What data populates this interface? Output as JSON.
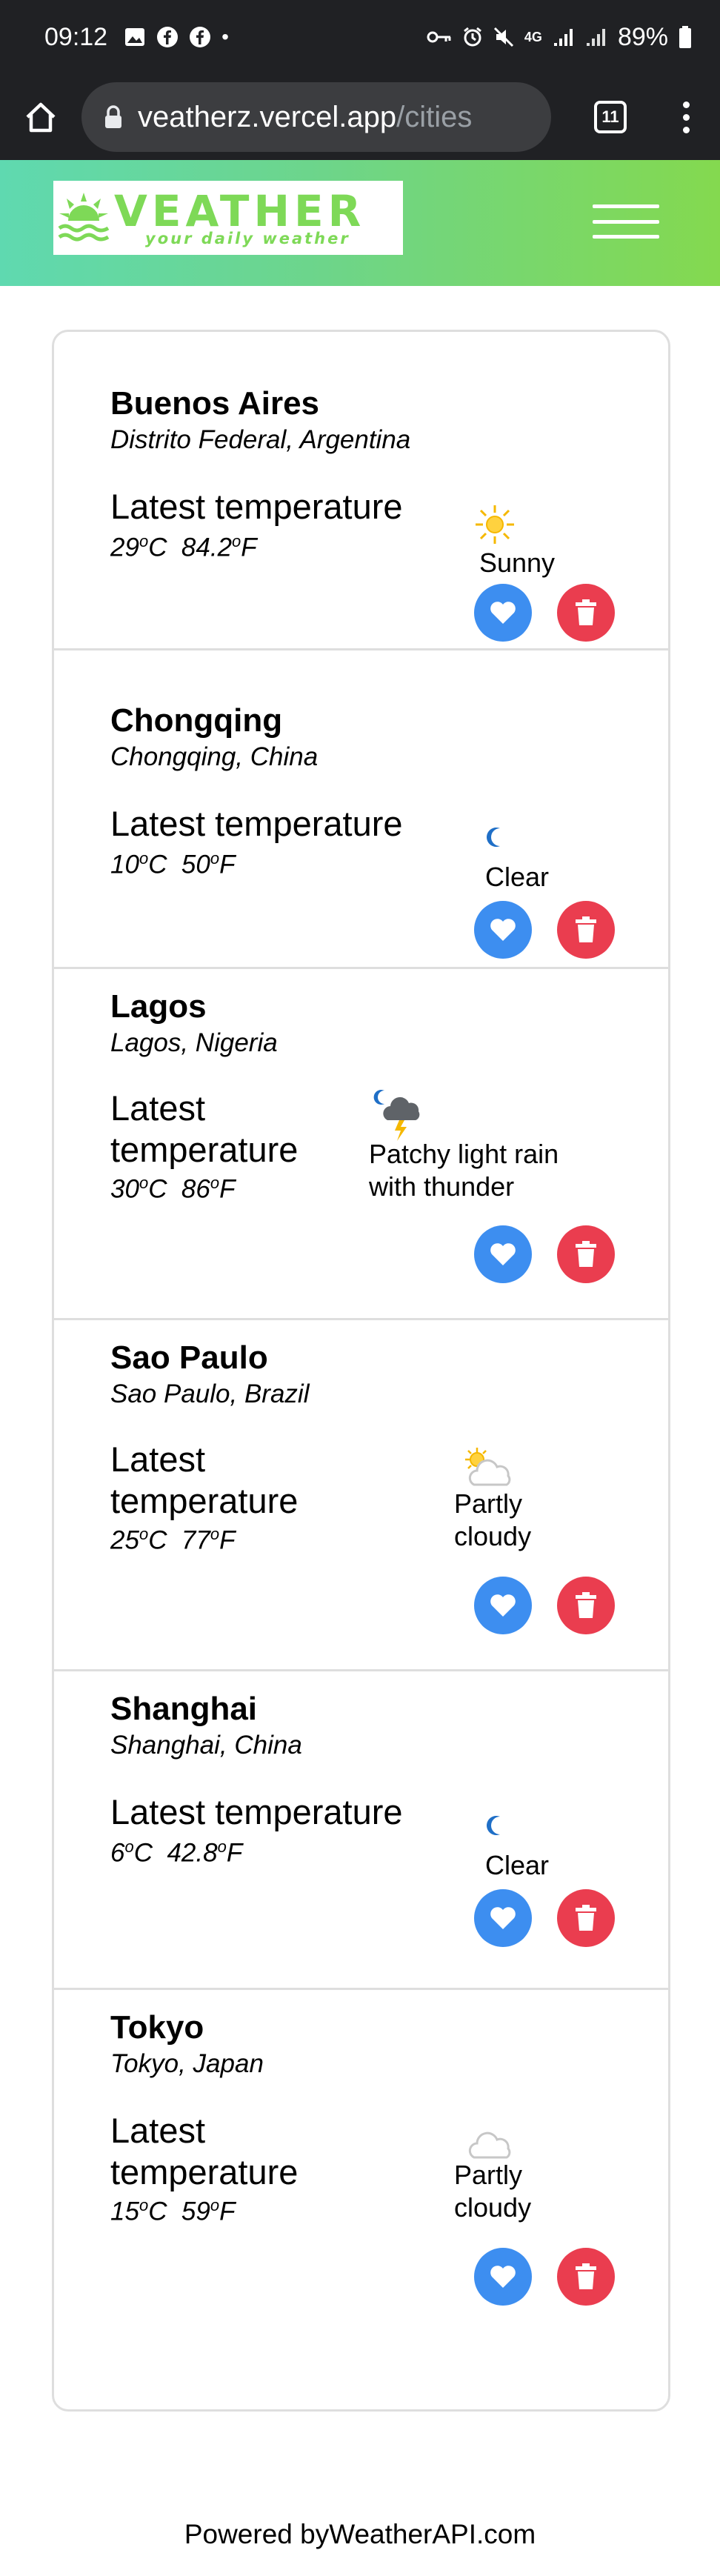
{
  "status_bar": {
    "time": "09:12",
    "battery": "89%",
    "network": "4G"
  },
  "browser": {
    "url_host": "veatherz.vercel.app",
    "url_path": "/cities",
    "tab_count": "11"
  },
  "header": {
    "logo_title": "VEATHER",
    "logo_tagline": "your daily weather"
  },
  "cities": [
    {
      "name": "Buenos Aires",
      "region": "Distrito Federal, Argentina",
      "temp_label": "Latest temperature",
      "temp_c": "29",
      "temp_f": "84.2",
      "condition": "Sunny",
      "icon": "sun-icon"
    },
    {
      "name": "Chongqing",
      "region": "Chongqing, China",
      "temp_label": "Latest temperature",
      "temp_c": "10",
      "temp_f": "50",
      "condition": "Clear",
      "icon": "moon-icon"
    },
    {
      "name": "Lagos",
      "region": "Lagos, Nigeria",
      "temp_label": "Latest temperature",
      "temp_c": "30",
      "temp_f": "86",
      "condition": "Patchy light rain with thunder",
      "icon": "thunder-rain-icon"
    },
    {
      "name": "Sao Paulo",
      "region": "Sao Paulo, Brazil",
      "temp_label": "Latest temperature",
      "temp_c": "25",
      "temp_f": "77",
      "condition": "Partly cloudy",
      "icon": "partly-cloudy-day-icon"
    },
    {
      "name": "Shanghai",
      "region": "Shanghai, China",
      "temp_label": "Latest temperature",
      "temp_c": "6",
      "temp_f": "42.8",
      "condition": "Clear",
      "icon": "moon-icon"
    },
    {
      "name": "Tokyo",
      "region": "Tokyo, Japan",
      "temp_label": "Latest temperature",
      "temp_c": "15",
      "temp_f": "59",
      "condition": "Partly cloudy",
      "icon": "partly-cloudy-night-icon"
    }
  ],
  "units": {
    "celsius": "C",
    "fahrenheit": "F",
    "degree": "o"
  },
  "footer": {
    "text": "Powered byWeatherAPI.com"
  },
  "colors": {
    "favorite_button": "#3d8ef0",
    "delete_button": "#ea3d4f",
    "brand_green": "#7ed957",
    "header_gradient_start": "#5fd9b0",
    "header_gradient_end": "#84d94f"
  }
}
